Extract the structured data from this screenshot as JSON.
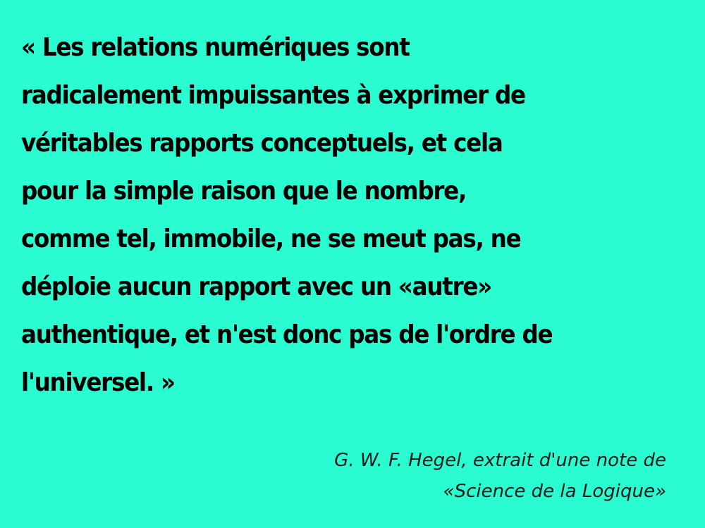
{
  "quote": {
    "lines": [
      "« Les relations numériques sont",
      "radicalement impuissantes à exprimer de",
      "véritables rapports conceptuels, et cela",
      "pour la simple raison que le nombre,",
      "comme tel, immobile, ne se meut pas, ne",
      "déploie aucun rapport avec un «autre»",
      "authentique, et n'est donc pas de l'ordre de",
      "l'universel. »"
    ]
  },
  "attribution": {
    "lines": [
      "G. W. F. Hegel, extrait d'une note de",
      "«Science de la Logique»"
    ]
  },
  "colors": {
    "background": "#2bfbd0",
    "text": "#000000"
  }
}
